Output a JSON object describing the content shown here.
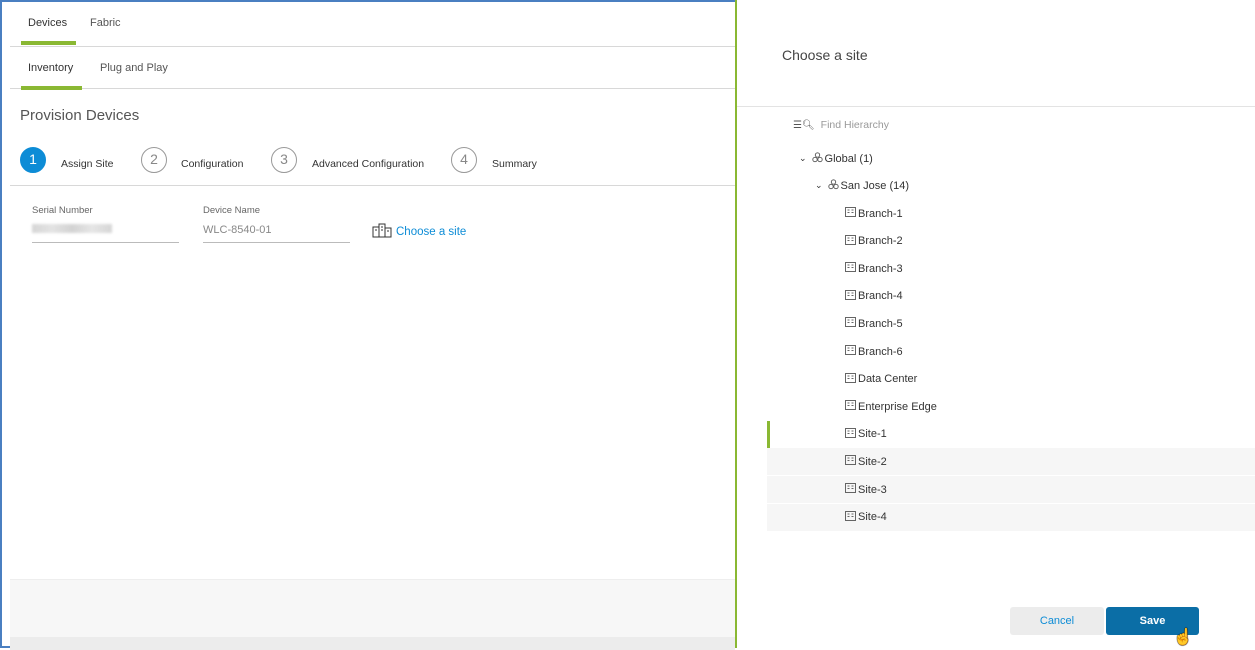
{
  "nav": {
    "tabs": [
      {
        "label": "Devices",
        "active": true
      },
      {
        "label": "Fabric",
        "active": false
      }
    ],
    "subtabs": [
      {
        "label": "Inventory",
        "active": true
      },
      {
        "label": "Plug and Play",
        "active": false
      }
    ]
  },
  "page": {
    "title": "Provision Devices"
  },
  "stepper": {
    "steps": [
      {
        "number": "1",
        "label": "Assign Site",
        "active": true
      },
      {
        "number": "2",
        "label": "Configuration",
        "active": false
      },
      {
        "number": "3",
        "label": "Advanced Configuration",
        "active": false
      },
      {
        "number": "4",
        "label": "Summary",
        "active": false
      }
    ]
  },
  "form": {
    "serial_label": "Serial Number",
    "device_name_label": "Device Name",
    "device_name_value": "WLC-8540-01",
    "choose_site_link": "Choose a site"
  },
  "panel": {
    "title": "Choose a site",
    "search_placeholder": "Find Hierarchy",
    "tree": [
      {
        "label": "Global (1)",
        "type": "area",
        "expanded": true
      },
      {
        "label": "San Jose (14)",
        "type": "area",
        "expanded": true
      },
      {
        "label": "Branch-1",
        "type": "building"
      },
      {
        "label": "Branch-2",
        "type": "building"
      },
      {
        "label": "Branch-3",
        "type": "building"
      },
      {
        "label": "Branch-4",
        "type": "building"
      },
      {
        "label": "Branch-5",
        "type": "building"
      },
      {
        "label": "Branch-6",
        "type": "building"
      },
      {
        "label": "Data Center",
        "type": "building"
      },
      {
        "label": "Enterprise Edge",
        "type": "building"
      },
      {
        "label": "Site-1",
        "type": "building",
        "selected": true
      },
      {
        "label": "Site-2",
        "type": "building"
      },
      {
        "label": "Site-3",
        "type": "building"
      },
      {
        "label": "Site-4",
        "type": "building"
      }
    ],
    "cancel_label": "Cancel",
    "save_label": "Save"
  },
  "colors": {
    "accent": "#8ab833",
    "primary": "#0b6ea6",
    "link": "#0d8cd6"
  }
}
